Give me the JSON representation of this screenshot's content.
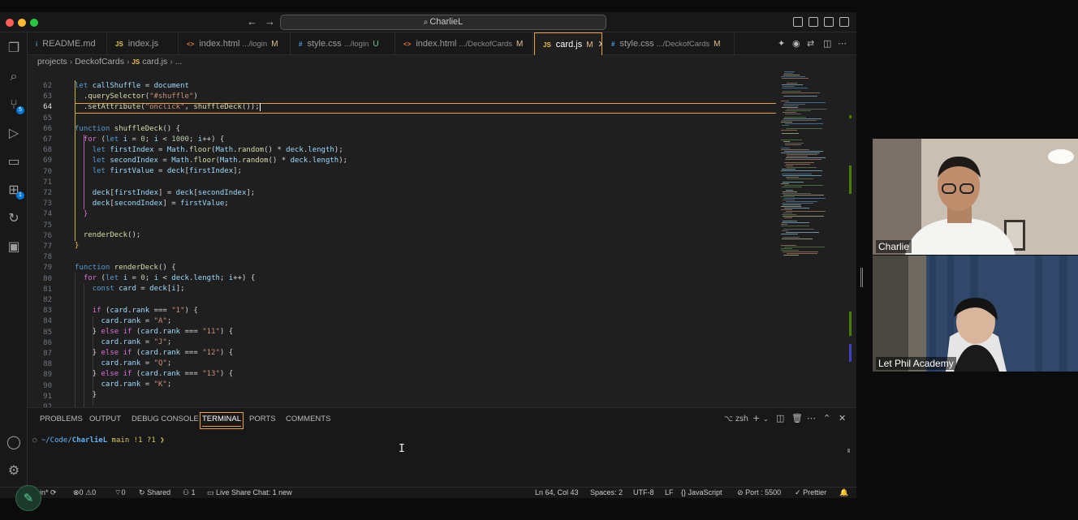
{
  "window": {
    "search_text": "CharlieL"
  },
  "activity_badges": {
    "source_control": "5",
    "extensions": "1"
  },
  "tabs": [
    {
      "icon": "i",
      "label": "README.md",
      "sub": "",
      "mod": ""
    },
    {
      "icon": "JS",
      "label": "index.js",
      "sub": "",
      "mod": ""
    },
    {
      "icon": "<>",
      "label": "index.html",
      "sub": ".../login",
      "mod": "M"
    },
    {
      "icon": "#",
      "label": "style.css",
      "sub": ".../login",
      "mod": "U"
    },
    {
      "icon": "<>",
      "label": "index.html",
      "sub": ".../DeckofCards",
      "mod": "M"
    },
    {
      "icon": "JS",
      "label": "card.js",
      "sub": "",
      "mod": "M"
    },
    {
      "icon": "#",
      "label": "style.css",
      "sub": ".../DeckofCards",
      "mod": "M"
    }
  ],
  "breadcrumb": {
    "p1": "projects",
    "p2": "DeckofCards",
    "p3": "card.js",
    "p4": "..."
  },
  "editor": {
    "line_numbers": [
      "62",
      "63",
      "64",
      "65",
      "66",
      "67",
      "68",
      "69",
      "70",
      "71",
      "72",
      "73",
      "74",
      "75",
      "76",
      "77",
      "78",
      "79",
      "80",
      "81",
      "82",
      "83",
      "84",
      "85",
      "86",
      "87",
      "88",
      "89",
      "90",
      "91",
      "92",
      "93"
    ],
    "current_line": "64"
  },
  "panel": {
    "tabs": [
      "PROBLEMS",
      "OUTPUT",
      "DEBUG CONSOLE",
      "TERMINAL",
      "PORTS",
      "COMMENTS"
    ],
    "active_tab": "TERMINAL",
    "shell": "zsh",
    "prompt_path_prefix": "~/Code/",
    "prompt_dir": "CharlieL",
    "prompt_git": " main !1 ?1 ❯"
  },
  "statusbar": {
    "branch": "ain*",
    "errors": "0",
    "warnings": "0",
    "ports": "0",
    "shared": "Shared",
    "participants": "1",
    "live_share": "Live Share Chat: 1 new",
    "position": "Ln 64, Col 43",
    "spaces": "Spaces: 2",
    "encoding": "UTF-8",
    "eol": "LF",
    "language": "JavaScript",
    "port": "Port : 5500",
    "prettier": "Prettier"
  },
  "participants": [
    {
      "name": "Charlie"
    },
    {
      "name": "Let Phil Academy"
    }
  ],
  "colors": {
    "accent": "#e8a33d",
    "modified": "#e2c08d",
    "keyword": "#569cd6",
    "function": "#dcdcaa",
    "string": "#ce9178"
  }
}
